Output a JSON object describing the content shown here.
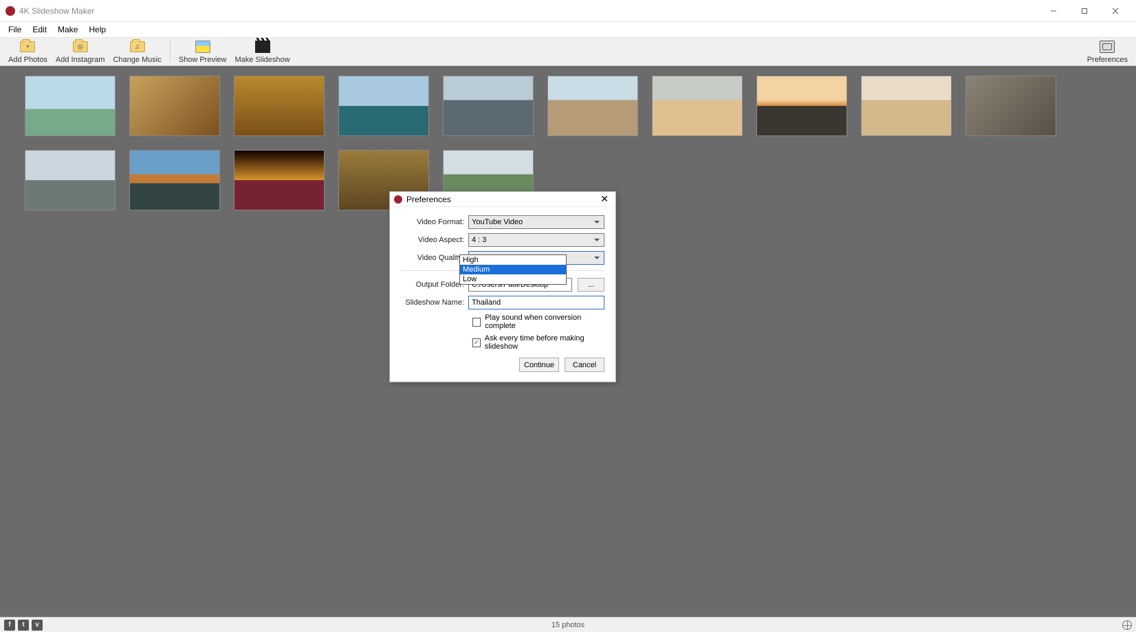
{
  "titlebar": {
    "title": "4K Slideshow Maker"
  },
  "menubar": [
    "File",
    "Edit",
    "Make",
    "Help"
  ],
  "toolbar": {
    "add_photos": "Add Photos",
    "add_instagram": "Add Instagram",
    "change_music": "Change Music",
    "show_preview": "Show Preview",
    "make_slideshow": "Make Slideshow",
    "preferences": "Preferences"
  },
  "thumbnail_count": 15,
  "statusbar": {
    "text": "15 photos"
  },
  "dialog": {
    "title": "Preferences",
    "video_format": {
      "label": "Video Format:",
      "value": "YouTube Video"
    },
    "video_aspect": {
      "label": "Video Aspect:",
      "value": "4 : 3"
    },
    "video_quality": {
      "label": "Video Quality:",
      "value": "High",
      "options": [
        "High",
        "Medium",
        "Low"
      ],
      "highlighted": "Medium"
    },
    "output_folder": {
      "label": "Output Folder:",
      "value": "C:/Users/Paul/Desktop",
      "browse": "..."
    },
    "slideshow_name": {
      "label": "Slideshow Name:",
      "value": "Thailand"
    },
    "chk_play_sound": {
      "label": "Play sound when conversion complete",
      "checked": false
    },
    "chk_ask_every": {
      "label": "Ask every time before making slideshow",
      "checked": true
    },
    "continue": "Continue",
    "cancel": "Cancel"
  }
}
